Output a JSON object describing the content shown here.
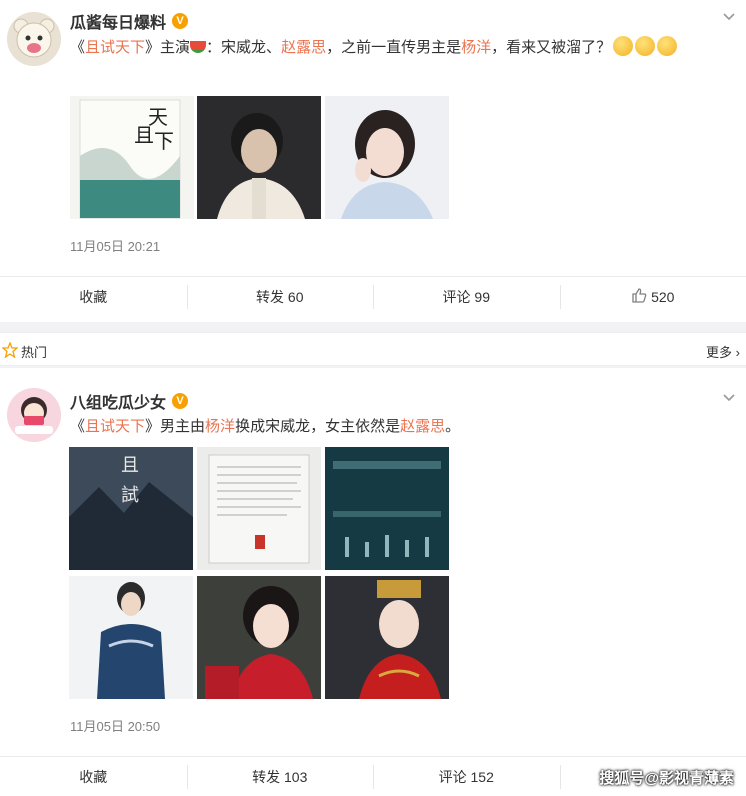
{
  "post1": {
    "username": "瓜酱每日爆料",
    "verified_badge": "V",
    "text_parts": [
      "《",
      "且试天下",
      "》主演",
      "：宋威龙、",
      "赵露思",
      "，之前一直传男主是",
      "杨洋",
      "，看来又被溜了？"
    ],
    "time": "11月05日 20:21",
    "actions": {
      "collect": "收藏",
      "repost": "转发 60",
      "comment": "评论 99",
      "like": "520"
    }
  },
  "hot_section": {
    "label": "热门",
    "more": "更多 ›"
  },
  "post2": {
    "username": "八组吃瓜少女",
    "verified_badge": "V",
    "text_parts": [
      "《",
      "且试天下",
      "》男主由",
      "杨洋",
      "换成宋威龙，女主依然是",
      "赵露思",
      "。"
    ],
    "time": "11月05日 20:50",
    "actions": {
      "collect": "收藏",
      "repost": "转发 103",
      "comment": "评论 152"
    }
  },
  "watermark": "搜狐号@影视青薄素",
  "colors": {
    "highlight": "#eb7350",
    "verified": "#f7a000",
    "meta": "#808080"
  }
}
